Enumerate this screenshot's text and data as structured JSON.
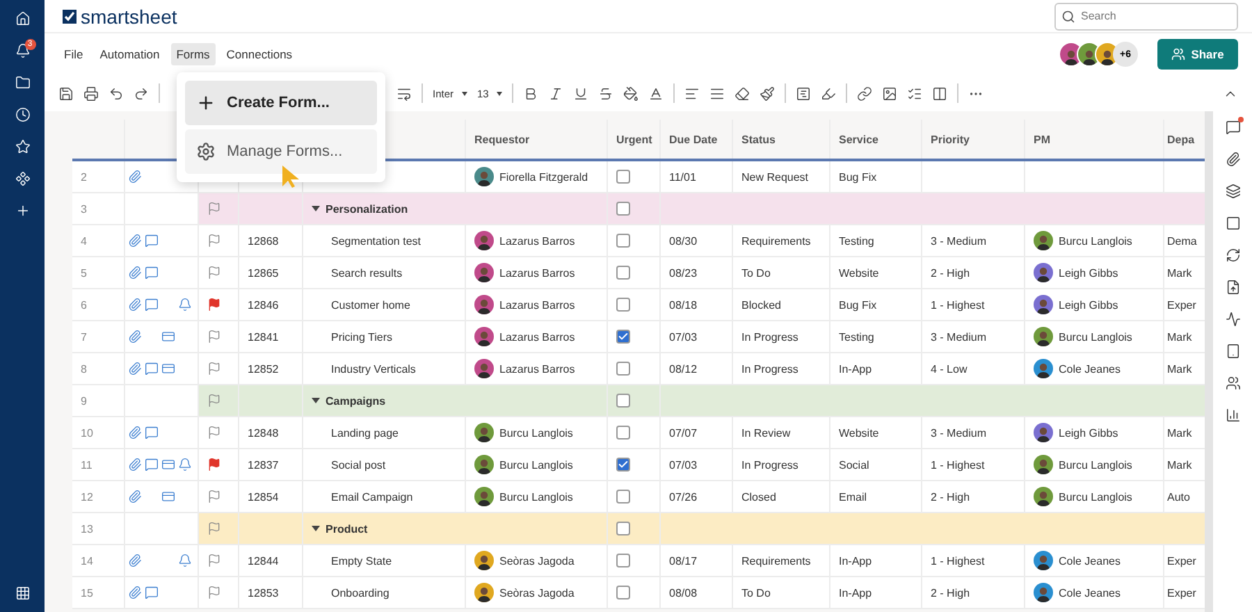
{
  "sidebar": {
    "notification_count": "3"
  },
  "header": {
    "logo": "smartsheet",
    "search": {
      "placeholder": "Search"
    }
  },
  "menu": [
    {
      "label": "File",
      "selected": false
    },
    {
      "label": "Automation",
      "selected": false
    },
    {
      "label": "Forms",
      "selected": true
    },
    {
      "label": "Connections",
      "selected": false
    }
  ],
  "collaborators": {
    "avatars": [
      {
        "color": "#c04a8a"
      },
      {
        "color": "#6f9a3c"
      },
      {
        "color": "#e0a820"
      }
    ],
    "more": "+6"
  },
  "share_button": "Share",
  "toolbar": {
    "font": "Inter",
    "size": "13"
  },
  "forms_menu": [
    {
      "kind": "create",
      "label": "Create Form...",
      "selected": true
    },
    {
      "kind": "manage",
      "label": "Manage Forms...",
      "selected": false
    }
  ],
  "columns": [
    "Requestor",
    "Urgent",
    "Due Date",
    "Status",
    "Service",
    "Priority",
    "PM",
    "Depa"
  ],
  "rows": [
    {
      "kind": "task",
      "num": "2",
      "attach": true,
      "comment": false,
      "proof": false,
      "reminder": false,
      "requestor": {
        "name": "Fiorella Fitzgerald",
        "color": "#4a8a8a"
      },
      "urgent": false,
      "due": "11/01",
      "status": "New Request",
      "service": "Bug Fix"
    },
    {
      "kind": "group",
      "num": "3",
      "title": "Personalization",
      "color": "#f5e1ec"
    },
    {
      "kind": "task",
      "num": "4",
      "attach": true,
      "comment": true,
      "proof": false,
      "reminder": false,
      "flagged": false,
      "id": "12868",
      "task": "Segmentation test",
      "requestor": {
        "name": "Lazarus Barros",
        "color": "#c04a8a"
      },
      "urgent": false,
      "due": "08/30",
      "status": "Requirements",
      "service": "Testing",
      "priority": "3 - Medium",
      "pm": {
        "name": "Burcu Langlois",
        "color": "#6f9a3c"
      },
      "dept": "Dema"
    },
    {
      "kind": "task",
      "num": "5",
      "attach": true,
      "comment": true,
      "proof": false,
      "reminder": false,
      "flagged": false,
      "id": "12865",
      "task": "Search results",
      "requestor": {
        "name": "Lazarus Barros",
        "color": "#c04a8a"
      },
      "urgent": false,
      "due": "08/23",
      "status": "To Do",
      "service": "Website",
      "priority": "2 - High",
      "pm": {
        "name": "Leigh Gibbs",
        "color": "#7a6fd0"
      },
      "dept": "Mark"
    },
    {
      "kind": "task",
      "num": "6",
      "attach": true,
      "comment": true,
      "proof": false,
      "reminder": true,
      "flagged": true,
      "id": "12846",
      "task": "Customer home",
      "requestor": {
        "name": "Lazarus Barros",
        "color": "#c04a8a"
      },
      "urgent": false,
      "due": "08/18",
      "status": "Blocked",
      "service": "Bug Fix",
      "priority": "1 - Highest",
      "pm": {
        "name": "Leigh Gibbs",
        "color": "#7a6fd0"
      },
      "dept": "Exper"
    },
    {
      "kind": "task",
      "num": "7",
      "attach": true,
      "comment": false,
      "proof": true,
      "reminder": false,
      "flagged": false,
      "id": "12841",
      "task": "Pricing Tiers",
      "requestor": {
        "name": "Lazarus Barros",
        "color": "#c04a8a"
      },
      "urgent": true,
      "due": "07/03",
      "status": "In Progress",
      "service": "Testing",
      "priority": "3 - Medium",
      "pm": {
        "name": "Burcu Langlois",
        "color": "#6f9a3c"
      },
      "dept": "Mark"
    },
    {
      "kind": "task",
      "num": "8",
      "attach": true,
      "comment": true,
      "proof": true,
      "reminder": false,
      "flagged": false,
      "id": "12852",
      "task": "Industry Verticals",
      "requestor": {
        "name": "Lazarus Barros",
        "color": "#c04a8a"
      },
      "urgent": false,
      "due": "08/12",
      "status": "In Progress",
      "service": "In-App",
      "priority": "4 - Low",
      "pm": {
        "name": "Cole Jeanes",
        "color": "#2a8fd0"
      },
      "dept": "Mark"
    },
    {
      "kind": "group",
      "num": "9",
      "title": "Campaigns",
      "color": "#e1ecd9"
    },
    {
      "kind": "task",
      "num": "10",
      "attach": true,
      "comment": true,
      "proof": false,
      "reminder": false,
      "flagged": false,
      "id": "12848",
      "task": "Landing page",
      "requestor": {
        "name": "Burcu Langlois",
        "color": "#6f9a3c"
      },
      "urgent": false,
      "due": "07/07",
      "status": "In Review",
      "service": "Website",
      "priority": "3 - Medium",
      "pm": {
        "name": "Leigh Gibbs",
        "color": "#7a6fd0"
      },
      "dept": "Mark"
    },
    {
      "kind": "task",
      "num": "11",
      "attach": true,
      "comment": true,
      "proof": true,
      "reminder": true,
      "flagged": true,
      "id": "12837",
      "task": "Social post",
      "requestor": {
        "name": "Burcu Langlois",
        "color": "#6f9a3c"
      },
      "urgent": true,
      "due": "07/03",
      "status": "In Progress",
      "service": "Social",
      "priority": "1 - Highest",
      "pm": {
        "name": "Burcu Langlois",
        "color": "#6f9a3c"
      },
      "dept": "Mark"
    },
    {
      "kind": "task",
      "num": "12",
      "attach": true,
      "comment": false,
      "proof": true,
      "reminder": false,
      "flagged": false,
      "id": "12854",
      "task": "Email Campaign",
      "requestor": {
        "name": "Burcu Langlois",
        "color": "#6f9a3c"
      },
      "urgent": false,
      "due": "07/26",
      "status": "Closed",
      "service": "Email",
      "priority": "2 - High",
      "pm": {
        "name": "Burcu Langlois",
        "color": "#6f9a3c"
      },
      "dept": "Auto"
    },
    {
      "kind": "group",
      "num": "13",
      "title": "Product",
      "color": "#fcecc4"
    },
    {
      "kind": "task",
      "num": "14",
      "attach": true,
      "comment": false,
      "proof": false,
      "reminder": true,
      "flagged": false,
      "id": "12844",
      "task": "Empty State",
      "requestor": {
        "name": "Seòras Jagoda",
        "color": "#e0a820"
      },
      "urgent": false,
      "due": "08/17",
      "status": "Requirements",
      "service": "In-App",
      "priority": "1 - Highest",
      "pm": {
        "name": "Cole Jeanes",
        "color": "#2a8fd0"
      },
      "dept": "Exper"
    },
    {
      "kind": "task",
      "num": "15",
      "attach": true,
      "comment": true,
      "proof": false,
      "reminder": false,
      "flagged": false,
      "id": "12853",
      "task": "Onboarding",
      "requestor": {
        "name": "Seòras Jagoda",
        "color": "#e0a820"
      },
      "urgent": false,
      "due": "08/08",
      "status": "To Do",
      "service": "In-App",
      "priority": "2 - High",
      "pm": {
        "name": "Cole Jeanes",
        "color": "#2a8fd0"
      },
      "dept": "Exper"
    }
  ]
}
